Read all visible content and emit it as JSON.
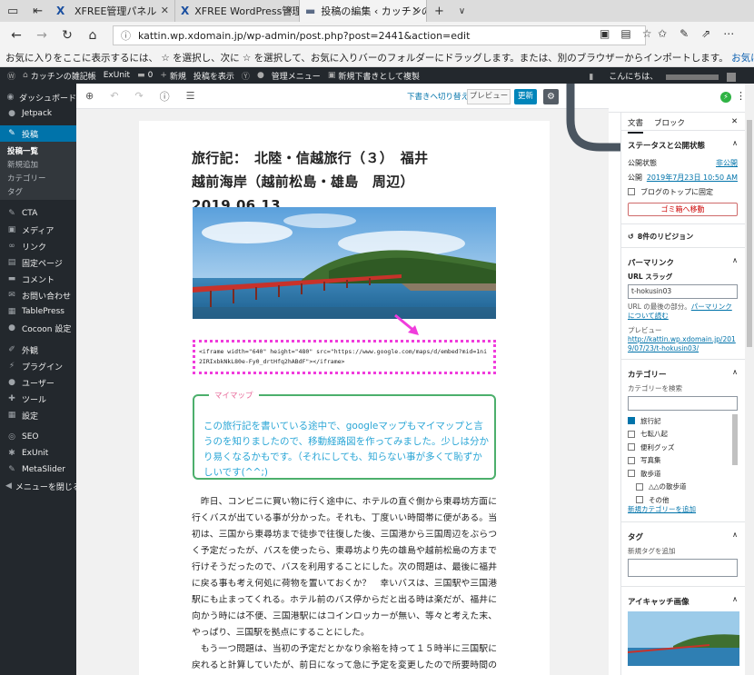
{
  "browser": {
    "tabs": [
      {
        "label": "XFREE管理パネル",
        "active": false
      },
      {
        "label": "XFREE WordPress管理パネル",
        "active": false
      },
      {
        "label": "投稿の編集 ‹ カッチンの雑",
        "active": true
      }
    ],
    "url": "kattin.wp.xdomain.jp/wp-admin/post.php?post=2441&action=edit",
    "favbar_text": "お気に入りをここに表示するには、 ☆ を選択し、次に ☆ を選択して、お気に入りバーのフォルダーにドラッグします。または、別のブラウザーからインポートします。",
    "favbar_link": "お気に入りのインポート"
  },
  "adminbar": {
    "site": "カッチンの雑記帳",
    "exunit": "ExUnit",
    "comments": "0",
    "new": "新規",
    "view_post": "投稿を表示",
    "admin_menu": "管理メニュー",
    "duplicate": "新規下書きとして複製",
    "greeting": "こんにちは、"
  },
  "sidebar": {
    "items": [
      {
        "icon": "dashboard-icon",
        "glyph": "◉",
        "label": "ダッシュボード"
      },
      {
        "icon": "jetpack-icon",
        "glyph": "●",
        "label": "Jetpack"
      }
    ],
    "posts": {
      "glyph": "✎",
      "label": "投稿"
    },
    "posts_sub": [
      "投稿一覧",
      "新規追加",
      "カテゴリー",
      "タグ"
    ],
    "items2": [
      {
        "icon": "cta-icon",
        "glyph": "✎",
        "label": "CTA"
      },
      {
        "icon": "media-icon",
        "glyph": "▣",
        "label": "メディア"
      },
      {
        "icon": "links-icon",
        "glyph": "∞",
        "label": "リンク"
      },
      {
        "icon": "pages-icon",
        "glyph": "▤",
        "label": "固定ページ"
      },
      {
        "icon": "comments-icon",
        "glyph": "▬",
        "label": "コメント"
      },
      {
        "icon": "mail-icon",
        "glyph": "✉",
        "label": "お問い合わせ"
      },
      {
        "icon": "tablepress-icon",
        "glyph": "▦",
        "label": "TablePress"
      },
      {
        "icon": "cocoon-icon",
        "glyph": "●",
        "label": "Cocoon 設定"
      }
    ],
    "items3": [
      {
        "icon": "appearance-icon",
        "glyph": "✐",
        "label": "外観"
      },
      {
        "icon": "plugins-icon",
        "glyph": "⚡",
        "label": "プラグイン"
      },
      {
        "icon": "users-icon",
        "glyph": "●",
        "label": "ユーザー"
      },
      {
        "icon": "tools-icon",
        "glyph": "✚",
        "label": "ツール"
      },
      {
        "icon": "settings-icon",
        "glyph": "▦",
        "label": "設定"
      }
    ],
    "items4": [
      {
        "icon": "seo-icon",
        "glyph": "◎",
        "label": "SEO"
      },
      {
        "icon": "exunit-icon",
        "glyph": "✱",
        "label": "ExUnit"
      },
      {
        "icon": "metaslider-icon",
        "glyph": "✎",
        "label": "MetaSlider"
      },
      {
        "icon": "collapse-icon",
        "glyph": "◀",
        "label": "メニューを閉じる"
      }
    ]
  },
  "editor": {
    "saved_draft": "下書きへ切り替え",
    "preview": "プレビュー",
    "update": "更新",
    "title_line1": "旅行記：　北陸・信越旅行（３）　福井",
    "title_line2": "越前海岸（越前松島・雄島　周辺）　　2019.06.13",
    "code": "<iframe width=\"640\" height=\"480\" src=\"https://www.google.com/maps/d/embed?mid=1ni2IRIxbkNkL80e-Fy0_drtHfq2hABdF\"></iframe>",
    "memo_label": "マイマップ",
    "memo_text": "この旅行記を書いている途中で、googleマップもマイマップと言うのを知りましたので、移動経路図を作ってみました。少しは分かり易くなるかもです。（それにしても、知らない事が多くて恥ずかしいです(^^;)",
    "body": [
      "　昨日、コンビニに買い物に行く途中に、ホテルの直ぐ側から東尋坊方面に行くバスが出ている事が分かった。それも、丁度いい時間帯に便がある。当初は、三国から東尋坊まで徒歩で往復した後、三国港から三国周辺をぶらつく予定だったが、バスを使ったら、東尋坊より先の雄島や越前松島の方まで行けそうだったので、バスを利用することにした。次の問題は、最後に福井に戻る事も考え何処に荷物を置いておくか？　幸いバスは、三国駅や三国港駅にも止まってくれる。ホテル前のバス停からだと出る時は楽だが、福井に向かう時には不便、三国港駅にはコインロッカーが無い、等々と考えた末、やっぱり、三国駅を拠点にすることにした。",
      "　もう一つ問題は、当初の予定だとかなり余裕を持って１５時半に三国駅に戻れると計算していたが、前日になって急に予定を変更したので所要時間の計算が出来ていない事。東尋坊、三国港間が１.４キロなので、１時間をみれば十分"
    ]
  },
  "panel": {
    "tab_doc": "文書",
    "tab_block": "ブロック",
    "status_title": "ステータスと公開状態",
    "visibility_label": "公開状態",
    "visibility_value": "非公開",
    "publish_label": "公開",
    "publish_value": "2019年7月23日 10:50 AM",
    "sticky": "ブログのトップに固定",
    "trash": "ゴミ箱へ移動",
    "revisions": "8件のリビジョン",
    "permalink_title": "パーマリンク",
    "slug_label": "URL スラッグ",
    "slug_value": "t-hokusin03",
    "slug_help": "URL の最後の部分。",
    "slug_link": "パーマリンクについて読む",
    "preview_label": "プレビュー",
    "preview_link": "http://kattin.wp.xdomain.jp/2019/07/23/t-hokusin03/",
    "categories_title": "カテゴリー",
    "cat_search": "カテゴリーを検索",
    "categories": [
      {
        "label": "旅行記",
        "checked": true,
        "indent": false
      },
      {
        "label": "七転八起",
        "checked": false,
        "indent": false
      },
      {
        "label": "便利グッズ",
        "checked": false,
        "indent": false
      },
      {
        "label": "写真集",
        "checked": false,
        "indent": false
      },
      {
        "label": "散歩道",
        "checked": false,
        "indent": false
      },
      {
        "label": "△△の散歩道",
        "checked": false,
        "indent": true
      },
      {
        "label": "その他",
        "checked": false,
        "indent": true
      }
    ],
    "add_category": "新規カテゴリーを追加",
    "tags_title": "タグ",
    "tag_add": "新規タグを追加",
    "featured_title": "アイキャッチ画像"
  }
}
